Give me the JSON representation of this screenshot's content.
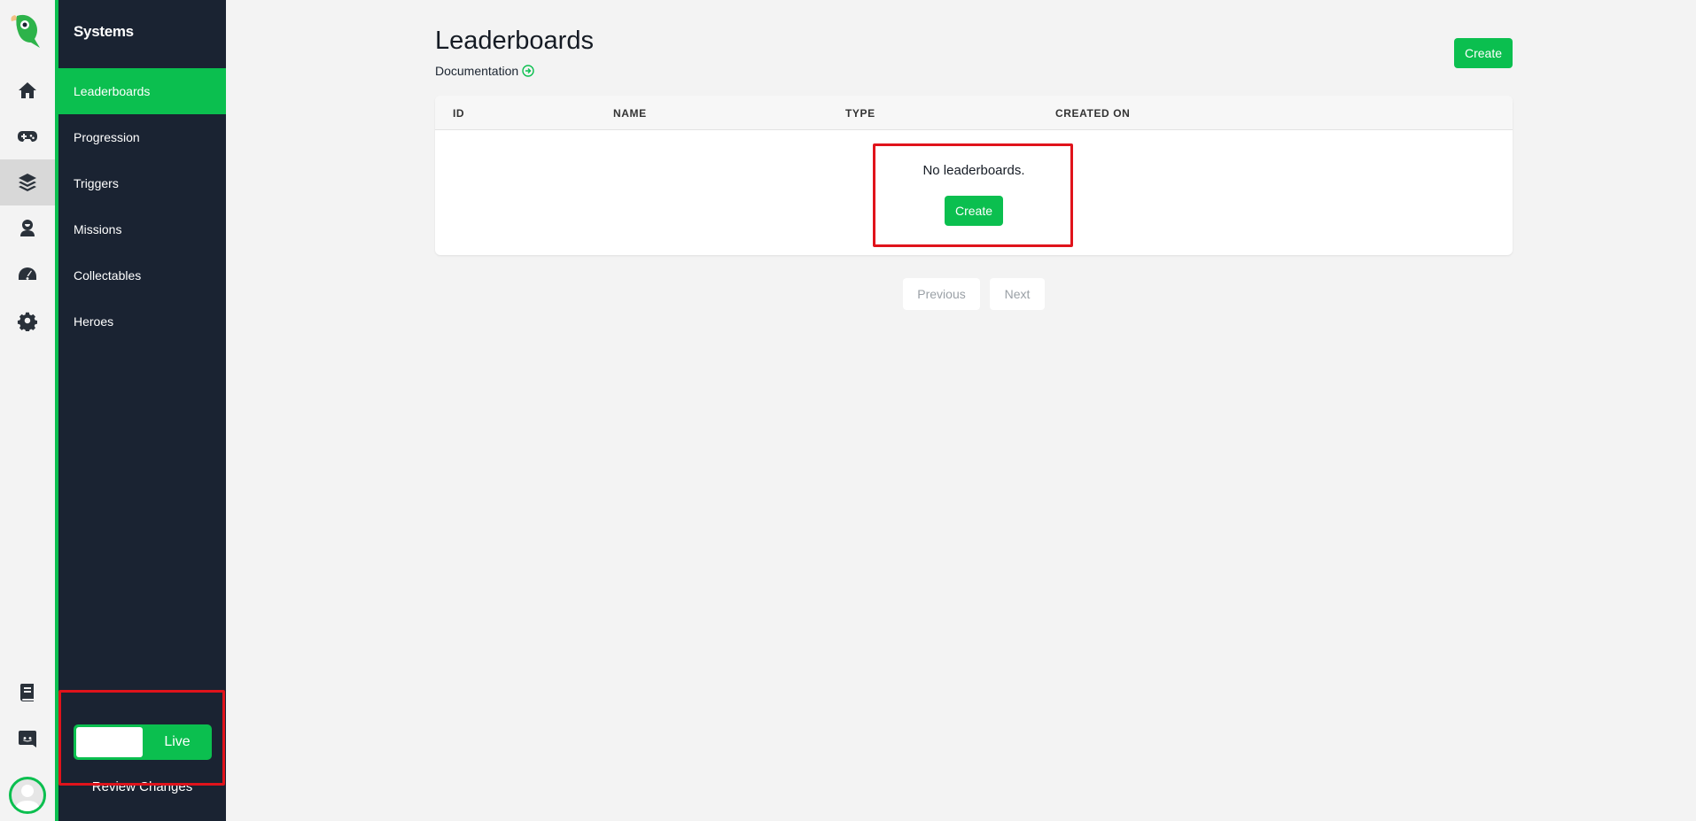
{
  "sidebar": {
    "title": "Systems",
    "items": [
      {
        "label": "Leaderboards"
      },
      {
        "label": "Progression"
      },
      {
        "label": "Triggers"
      },
      {
        "label": "Missions"
      },
      {
        "label": "Collectables"
      },
      {
        "label": "Heroes"
      }
    ],
    "live_label": "Live",
    "review_label": "Review Changes"
  },
  "rail": {
    "icons": [
      "home-icon",
      "gamepad-icon",
      "layers-icon",
      "agent-icon",
      "dashboard-icon",
      "gear-icon",
      "book-icon",
      "discord-icon"
    ],
    "active": "layers-icon"
  },
  "header": {
    "title": "Leaderboards",
    "doc_link": "Documentation",
    "create_label": "Create"
  },
  "table": {
    "columns": [
      "ID",
      "NAME",
      "TYPE",
      "CREATED ON"
    ],
    "rows": [],
    "empty_text": "No leaderboards.",
    "empty_create_label": "Create"
  },
  "pagination": {
    "previous_label": "Previous",
    "next_label": "Next"
  },
  "colors": {
    "accent": "#0bbf4f",
    "sidebar_bg": "#1a2332",
    "highlight": "#e0131b"
  }
}
